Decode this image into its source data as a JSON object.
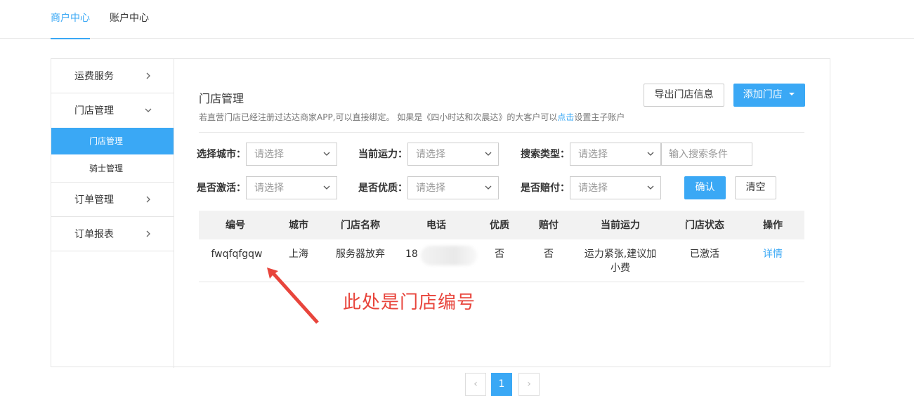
{
  "topnav": {
    "tabs": [
      {
        "label": "商户中心",
        "active": true
      },
      {
        "label": "账户中心",
        "active": false
      }
    ]
  },
  "sidebar": {
    "items": [
      {
        "label": "运费服务",
        "icon": "chevron-right-icon"
      },
      {
        "label": "门店管理",
        "icon": "chevron-down-icon"
      },
      {
        "label": "订单管理",
        "icon": "chevron-right-icon"
      },
      {
        "label": "订单报表",
        "icon": "chevron-right-icon"
      }
    ],
    "subitems": [
      {
        "label": "门店管理",
        "active": true
      },
      {
        "label": "骑士管理",
        "active": false
      }
    ]
  },
  "main": {
    "title": "门店管理",
    "subtitle_before": "若直营门店已经注册过达达商家APP,可以直接绑定。 如果是《四小时达和次晨达》的大客户可以",
    "subtitle_link": "点击",
    "subtitle_after": "设置主子账户",
    "export_button": "导出门店信息",
    "add_button": "添加门店",
    "add_button_icon": "caret-down-icon"
  },
  "filters": {
    "city_label": "选择城市：",
    "capacity_label": "当前运力：",
    "search_type_label": "搜索类型：",
    "activated_label": "是否激活：",
    "quality_label": "是否优质：",
    "compensation_label": "是否赔付：",
    "select_placeholder": "请选择",
    "search_placeholder": "输入搜索条件",
    "confirm_button": "确认",
    "clear_button": "清空"
  },
  "table": {
    "headers": [
      "编号",
      "城市",
      "门店名称",
      "电话",
      "优质",
      "赔付",
      "当前运力",
      "门店状态",
      "操作"
    ],
    "rows": [
      {
        "id": "fwqfqfgqw",
        "city": "上海",
        "name": "服务器放弃",
        "phone": "18",
        "quality": "否",
        "compensation": "否",
        "capacity_line1": "运力紧张,建议加",
        "capacity_line2": "小费",
        "status": "已激活",
        "action": "详情"
      }
    ]
  },
  "annotation": {
    "text": "此处是门店编号",
    "color": "#e8453c"
  },
  "pagination": {
    "prev": "‹",
    "current": "1",
    "next": "›"
  },
  "colors": {
    "accent": "#3aa8f5"
  }
}
